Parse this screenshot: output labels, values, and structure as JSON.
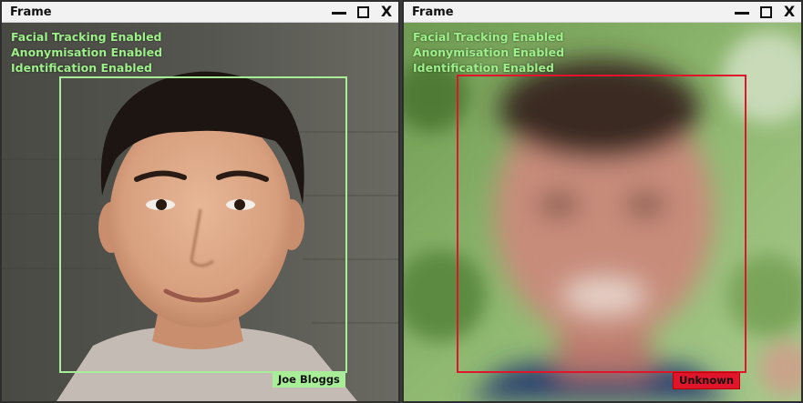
{
  "windows": [
    {
      "title": "Frame",
      "controls": {
        "minimize": "minimize",
        "maximize": "maximize",
        "close": "X"
      },
      "status_lines": [
        "Facial Tracking Enabled",
        "Anonymisation Enabled",
        "Identification Enabled"
      ],
      "detection": {
        "label": "Joe Bloggs",
        "color": "#a8ee98"
      }
    },
    {
      "title": "Frame",
      "controls": {
        "minimize": "minimize",
        "maximize": "maximize",
        "close": "X"
      },
      "status_lines": [
        "Facial Tracking Enabled",
        "Anonymisation Enabled",
        "Identification Enabled"
      ],
      "detection": {
        "label": "Unknown",
        "color": "#e0142a"
      }
    }
  ],
  "colors": {
    "overlay_text": "#9ef08a",
    "titlebar": "#f2f2f2"
  }
}
